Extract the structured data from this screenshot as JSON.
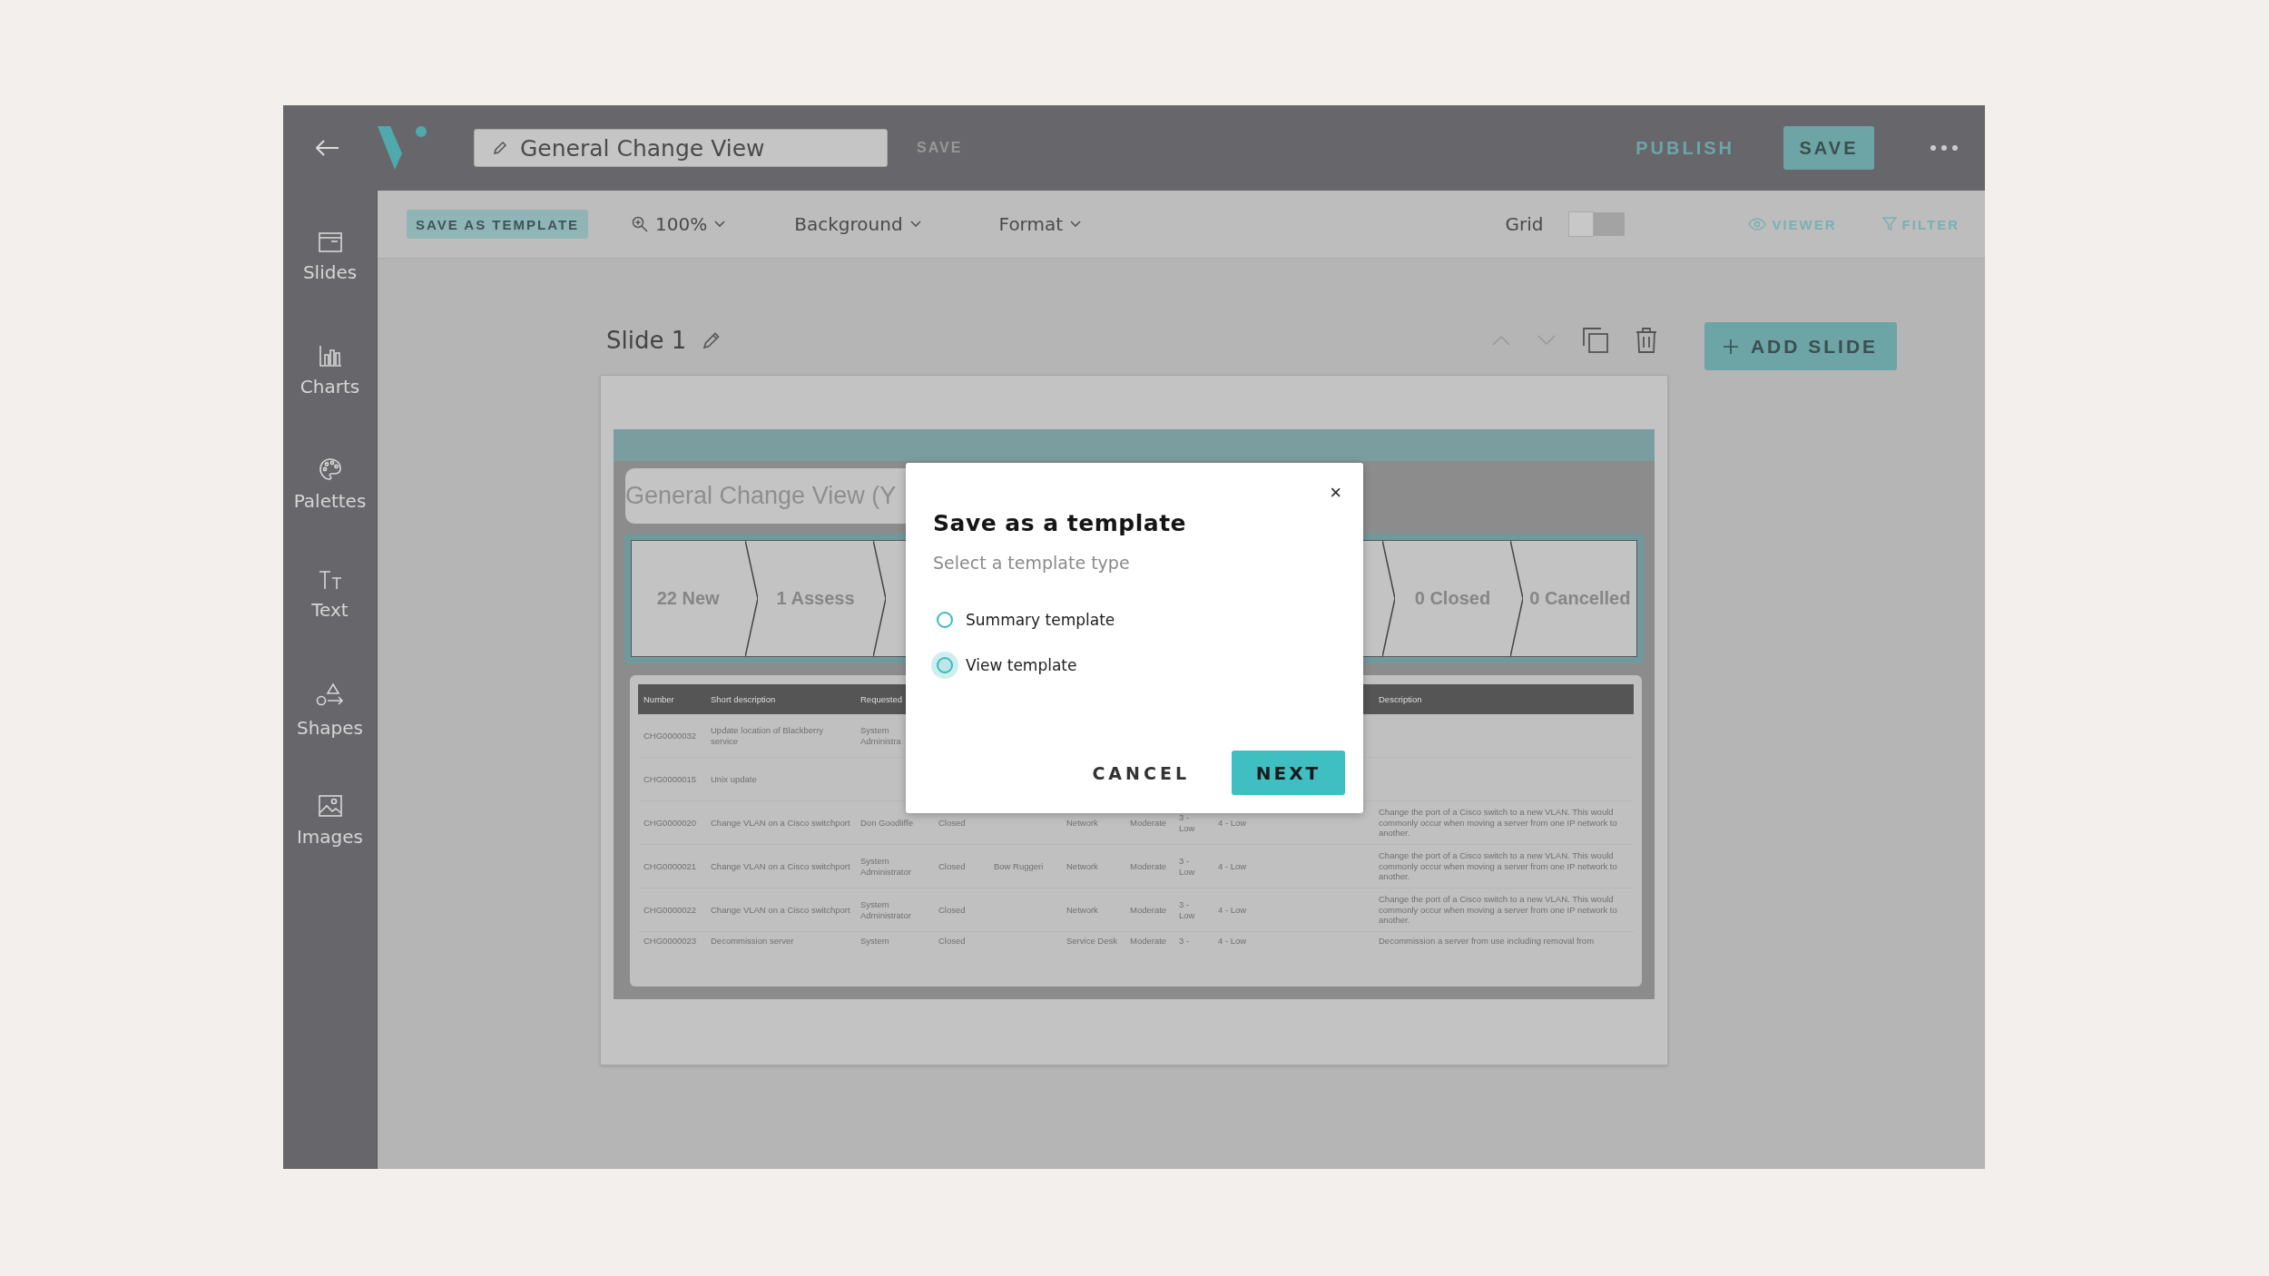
{
  "top_bar": {
    "title": "General Change View",
    "save_link": "SAVE",
    "publish": "PUBLISH",
    "save_button": "SAVE"
  },
  "toolbar": {
    "save_as_template": "SAVE AS TEMPLATE",
    "zoom": "100%",
    "background": "Background",
    "format": "Format",
    "grid": {
      "label": "Grid",
      "on": false
    },
    "viewer": "VIEWER",
    "filter": "FILTER"
  },
  "sidebar": {
    "items": [
      {
        "label": "Slides",
        "kind": "slides"
      },
      {
        "label": "Charts",
        "kind": "charts"
      },
      {
        "label": "Palettes",
        "kind": "palettes"
      },
      {
        "label": "Text",
        "kind": "text"
      },
      {
        "label": "Shapes",
        "kind": "shapes"
      },
      {
        "label": "Images",
        "kind": "images"
      }
    ]
  },
  "slide_header": {
    "title": "Slide 1",
    "add_slide": "ADD SLIDE"
  },
  "slide": {
    "title": "General Change View (Y",
    "steps_start": [
      "22 New",
      "1 Assess"
    ],
    "steps_end": [
      "0 Closed",
      "0 Cancelled"
    ],
    "table": {
      "columns": [
        "Number",
        "Short description",
        "Requested"
      ],
      "last_column": "Description",
      "rows": [
        {
          "number": "CHG0000032",
          "short_description": "Update location of Blackberry service",
          "requested": "System Administra"
        },
        {
          "number": "CHG0000015",
          "short_description": "Unix update"
        },
        {
          "number": "CHG0000020",
          "short_description": "Change VLAN on a Cisco switchport",
          "requested": "Don Goodliffe",
          "column_4": "Closed",
          "column_6": "Network",
          "column_7": "Moderate",
          "column_8": "3 - Low",
          "column_9": "4 - Low",
          "description": "Change the port of a Cisco switch to a new VLAN. This would commonly occur when moving a server from one IP network to another."
        },
        {
          "number": "CHG0000021",
          "short_description": "Change VLAN on a Cisco switchport",
          "requested": "System Administrator",
          "column_4": "Closed",
          "column_5": "Bow Ruggeri",
          "column_6": "Network",
          "column_7": "Moderate",
          "column_8": "3 - Low",
          "column_9": "4 - Low",
          "description": "Change the port of a Cisco switch to a new VLAN. This would commonly occur when moving a server from one IP network to another."
        },
        {
          "number": "CHG0000022",
          "short_description": "Change VLAN on a Cisco switchport",
          "requested": "System Administrator",
          "column_4": "Closed",
          "column_6": "Network",
          "column_7": "Moderate",
          "column_8": "3 - Low",
          "column_9": "4 - Low",
          "description": "Change the port of a Cisco switch to a new VLAN. This would commonly occur when moving a server from one IP network to another."
        },
        {
          "number": "CHG0000023",
          "short_description": "Decommission server",
          "requested": "System",
          "column_4": "Closed",
          "column_6": "Service Desk",
          "column_7": "Moderate",
          "column_8": "3 -",
          "column_9": "4 - Low",
          "description": "Decommission a server from use including removal from"
        }
      ]
    }
  },
  "dialog": {
    "title": "Save as a template",
    "subtitle": "Select a template type",
    "close": "×",
    "options": [
      {
        "label": "Summary template",
        "selected": false,
        "focused": false
      },
      {
        "label": "View template",
        "selected": false,
        "focused": true
      }
    ],
    "cancel": "CANCEL",
    "next": "NEXT"
  }
}
